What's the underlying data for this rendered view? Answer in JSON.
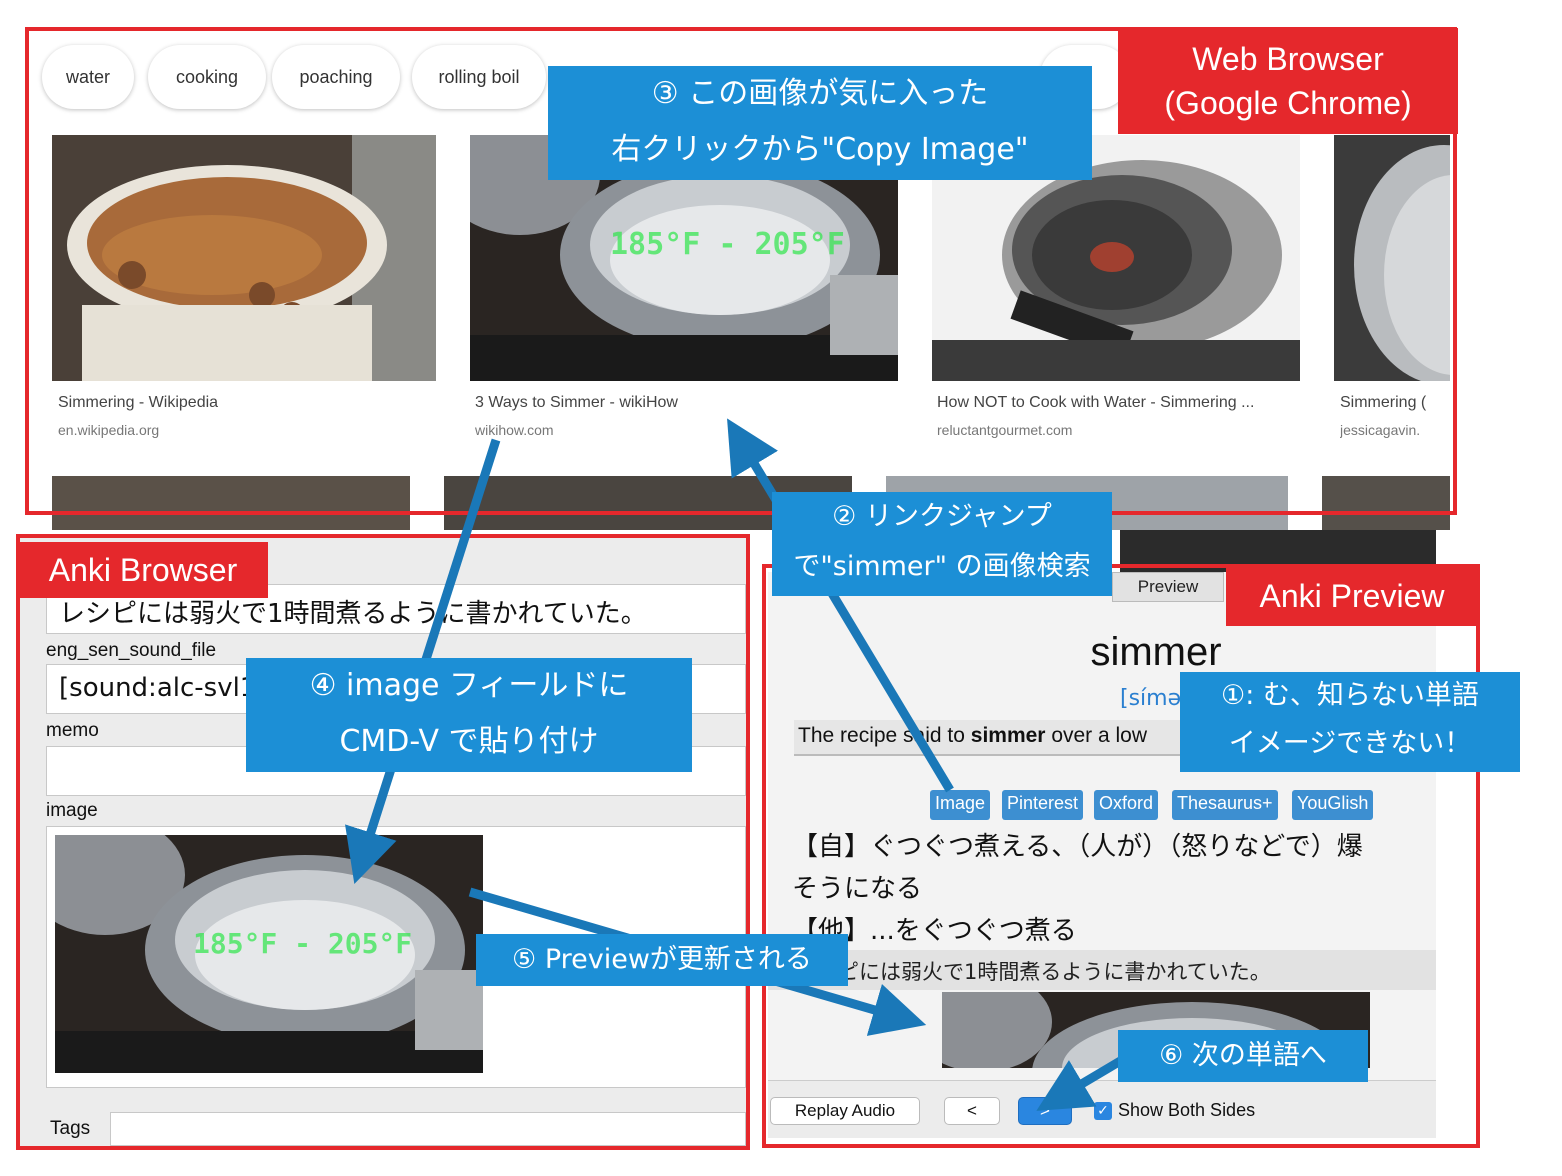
{
  "web_browser": {
    "chips": [
      "water",
      "cooking",
      "poaching",
      "rolling boil"
    ],
    "results": [
      {
        "title": "Simmering - Wikipedia",
        "site": "en.wikipedia.org"
      },
      {
        "title": "3 Ways to Simmer - wikiHow",
        "site": "wikihow.com",
        "overlay_text": "185°F - 205°F"
      },
      {
        "title": "How NOT to Cook with Water - Simmering ...",
        "site": "reluctantgourmet.com"
      },
      {
        "title": "Simmering (",
        "site": "jessicagavin."
      }
    ]
  },
  "anki_browser": {
    "sentence_field_value": "レシピには弱火で1時間煮るように書かれていた。",
    "eng_sen_sound_file_label": "eng_sen_sound_file",
    "eng_sen_sound_file_value": "[sound:alc-svl10",
    "memo_label": "memo",
    "memo_value": "",
    "image_label": "image",
    "image_overlay_text": "185°F - 205°F",
    "tags_label": "Tags",
    "tags_value": ""
  },
  "anki_preview": {
    "tab_label": "Preview",
    "word": "simmer",
    "pronunciation": "[símə",
    "example_prefix": "The recipe said to ",
    "example_bold": "simmer",
    "example_suffix": " over a low",
    "link_buttons": [
      "Image",
      "Pinterest",
      "Oxford",
      "Thesaurus+",
      "YouGlish"
    ],
    "def_line1": "【自】ぐつぐつ煮える、（人が）（怒りなどで）爆",
    "def_line2": "そうになる",
    "def_line3": "【他】...をぐつぐつ煮る",
    "sentence_ja": "ピには弱火で1時間煮るように書かれていた。",
    "replay_audio_label": "Replay Audio",
    "prev_label": "<",
    "next_label": ">",
    "show_both_sides_label": "Show Both Sides",
    "show_both_sides_checked": true
  },
  "labels": {
    "web_browser_line1": "Web Browser",
    "web_browser_line2": "(Google Chrome)",
    "anki_browser": "Anki Browser",
    "anki_preview": "Anki Preview"
  },
  "callouts": {
    "step1_line1": "①: む、知らない単語",
    "step1_line2": "イメージできない！",
    "step2_line1": "② リンクジャンプ",
    "step2_line2": "で\"simmer\" の画像検索",
    "step3_line1": "③ この画像が気に入った",
    "step3_line2": "右クリックから\"Copy Image\"",
    "step4_line1": "④ image フィールドに",
    "step4_line2": "CMD-V で貼り付け",
    "step5": "⑤ Previewが更新される",
    "step6": "⑥ 次の単語へ"
  },
  "colors": {
    "frame_red": "#e5282c",
    "callout_blue": "#1c8fd6",
    "arrow_blue": "#1a78b8",
    "link_button_blue": "#3d8fd1"
  }
}
